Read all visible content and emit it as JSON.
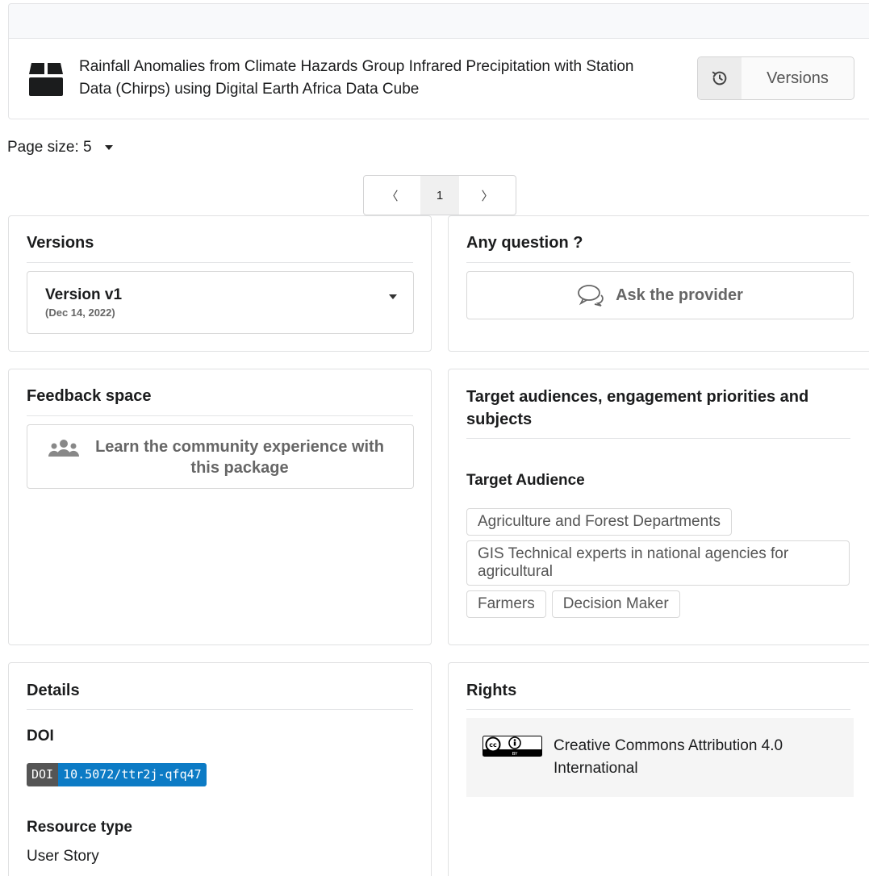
{
  "header": {
    "title": "Rainfall Anomalies from Climate Hazards Group Infrared Precipitation with Station Data (Chirps) using Digital Earth Africa Data Cube",
    "versions_button": "Versions"
  },
  "page_size": {
    "label": "Page size: 5"
  },
  "pagination": {
    "prev": "〈",
    "current": "1",
    "next": "〉"
  },
  "versions_card": {
    "title": "Versions",
    "selected_version": "Version v1",
    "selected_date": "(Dec 14, 2022)"
  },
  "question_card": {
    "title": "Any question ?",
    "button": "Ask the provider"
  },
  "feedback_card": {
    "title": "Feedback space",
    "button": "Learn the community experience with this package"
  },
  "audience_card": {
    "title": "Target audiences, engagement priorities and subjects",
    "subtitle": "Target Audience",
    "tags": [
      "Agriculture and Forest Departments",
      "GIS Technical experts in national agencies for agricultural",
      "Farmers",
      "Decision Maker"
    ]
  },
  "details_card": {
    "title": "Details",
    "doi_label": "DOI",
    "doi_badge_key": "DOI",
    "doi_value": "10.5072/ttr2j-qfq47",
    "resource_type_label": "Resource type",
    "resource_type_value": "User Story"
  },
  "rights_card": {
    "title": "Rights",
    "license": "Creative Commons Attribution 4.0 International",
    "icon_text": [
      "cc",
      "BY"
    ]
  },
  "colors": {
    "doi_key_bg": "#555555",
    "doi_value_bg": "#0c7bc5",
    "border": "#e0e1e2"
  }
}
